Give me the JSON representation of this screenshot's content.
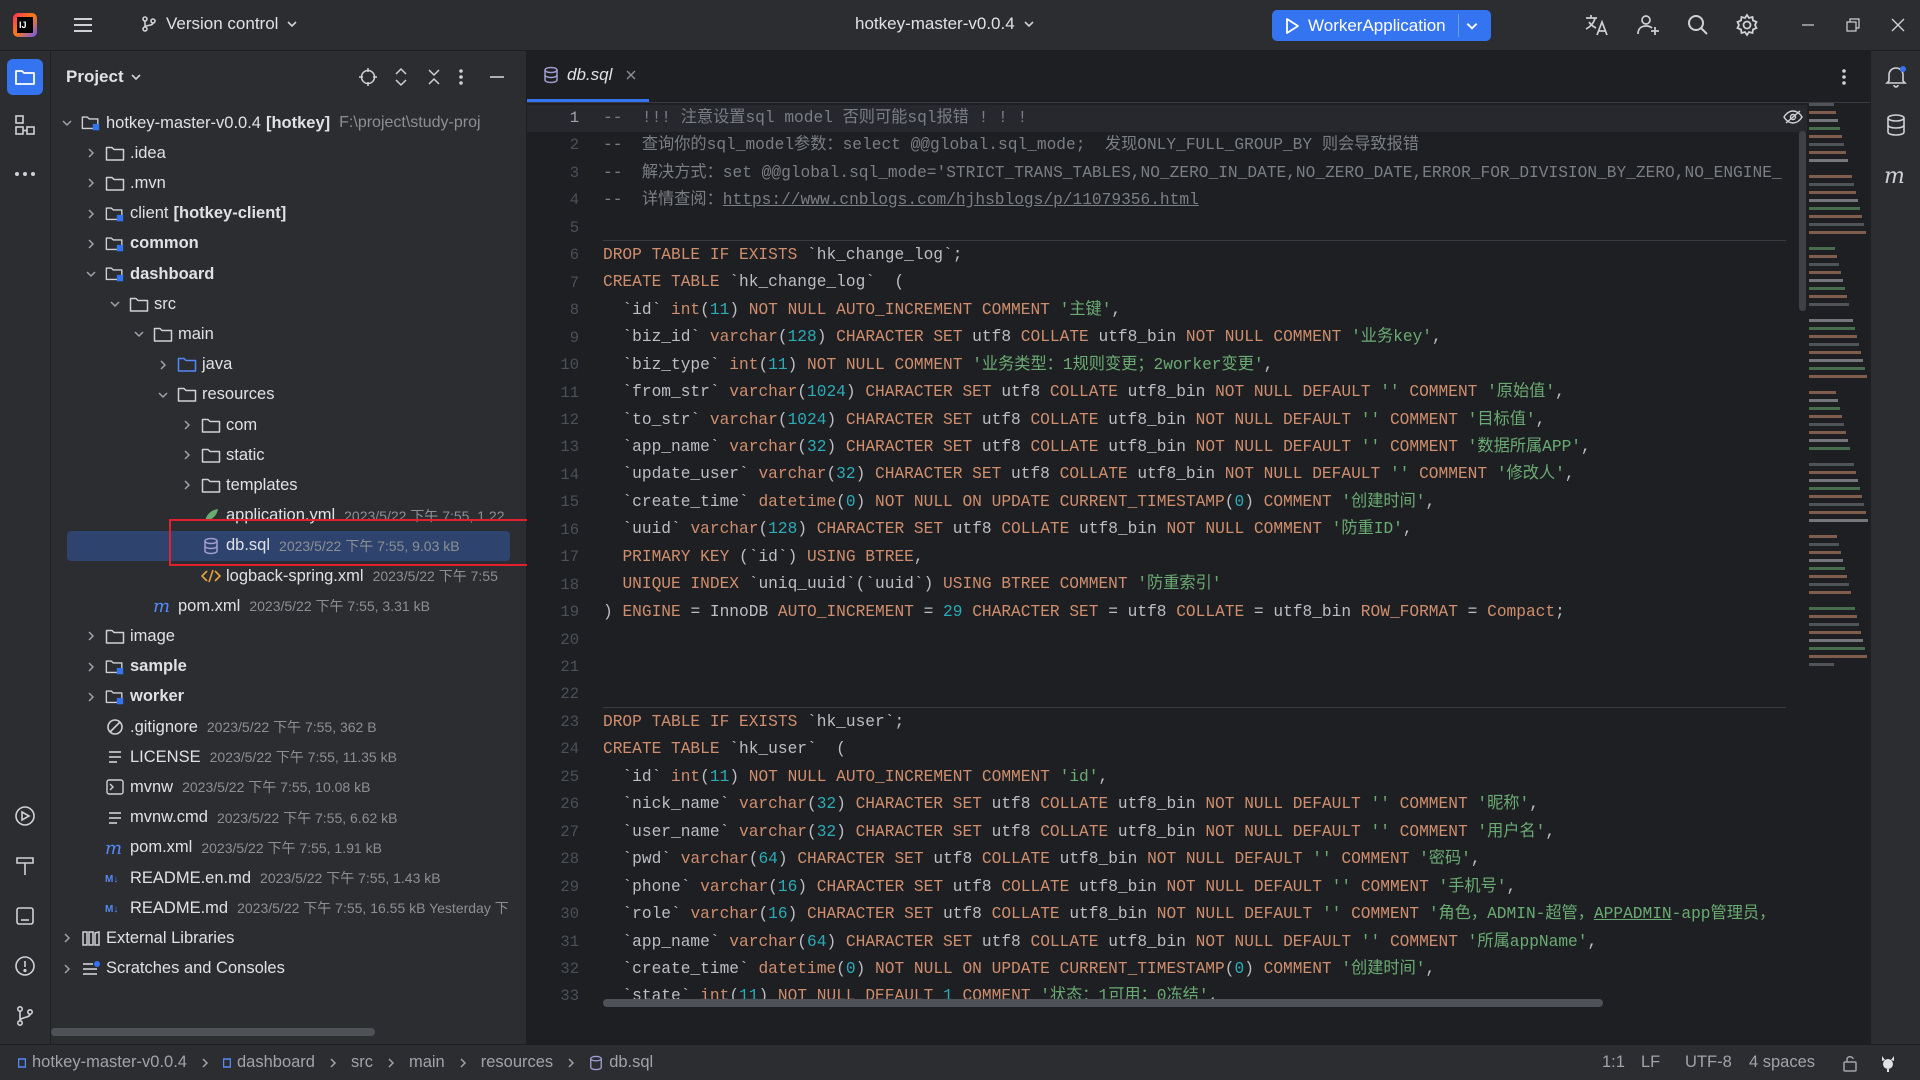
{
  "titlebar": {
    "vcs_label": "Version control",
    "project_name": "hotkey-master-v0.0.4",
    "run_config": "WorkerApplication"
  },
  "project_panel": {
    "title": "Project",
    "rows": [
      {
        "name": "hotkey-master-v0.0.4",
        "bold_suffix": "[hotkey]",
        "path": "F:\\project\\study-proj"
      },
      {
        "name": ".idea"
      },
      {
        "name": ".mvn"
      },
      {
        "name": "client",
        "bold_suffix": "[hotkey-client]"
      },
      {
        "name": "common"
      },
      {
        "name": "dashboard"
      },
      {
        "name": "src"
      },
      {
        "name": "main"
      },
      {
        "name": "java"
      },
      {
        "name": "resources"
      },
      {
        "name": "com"
      },
      {
        "name": "static"
      },
      {
        "name": "templates"
      },
      {
        "name": "application.yml",
        "meta": "2023/5/22 下午 7:55, 1.22"
      },
      {
        "name": "db.sql",
        "meta": "2023/5/22 下午 7:55, 9.03 kB"
      },
      {
        "name": "logback-spring.xml",
        "meta": "2023/5/22 下午 7:55"
      },
      {
        "name": "pom.xml",
        "meta": "2023/5/22 下午 7:55, 3.31 kB"
      },
      {
        "name": "image"
      },
      {
        "name": "sample"
      },
      {
        "name": "worker"
      },
      {
        "name": ".gitignore",
        "meta": "2023/5/22 下午 7:55, 362 B"
      },
      {
        "name": "LICENSE",
        "meta": "2023/5/22 下午 7:55, 11.35 kB"
      },
      {
        "name": "mvnw",
        "meta": "2023/5/22 下午 7:55, 10.08 kB"
      },
      {
        "name": "mvnw.cmd",
        "meta": "2023/5/22 下午 7:55, 6.62 kB"
      },
      {
        "name": "pom.xml",
        "meta": "2023/5/22 下午 7:55, 1.91 kB"
      },
      {
        "name": "README.en.md",
        "meta": "2023/5/22 下午 7:55, 1.43 kB"
      },
      {
        "name": "README.md",
        "meta": "2023/5/22 下午 7:55, 16.55 kB Yesterday 下"
      },
      {
        "name": "External Libraries"
      },
      {
        "name": "Scratches and Consoles"
      }
    ]
  },
  "editor": {
    "tab_label": "db.sql",
    "line_numbers": [
      "1",
      "2",
      "3",
      "4",
      "5",
      "6",
      "7",
      "8",
      "9",
      "10",
      "11",
      "12",
      "13",
      "14",
      "15",
      "16",
      "17",
      "18",
      "19",
      "20",
      "21",
      "22",
      "23",
      "24",
      "25",
      "26",
      "27",
      "28",
      "29",
      "30",
      "31",
      "32",
      "33"
    ]
  },
  "statusbar": {
    "breadcrumbs": [
      "hotkey-master-v0.0.4",
      "dashboard",
      "src",
      "main",
      "resources",
      "db.sql"
    ],
    "position": "1:1",
    "line_sep": "LF",
    "encoding": "UTF-8",
    "indent": "4 spaces"
  },
  "colors": {
    "accent": "#3574f0",
    "selection": "#2e436e",
    "highlight_box": "#e5202e"
  }
}
